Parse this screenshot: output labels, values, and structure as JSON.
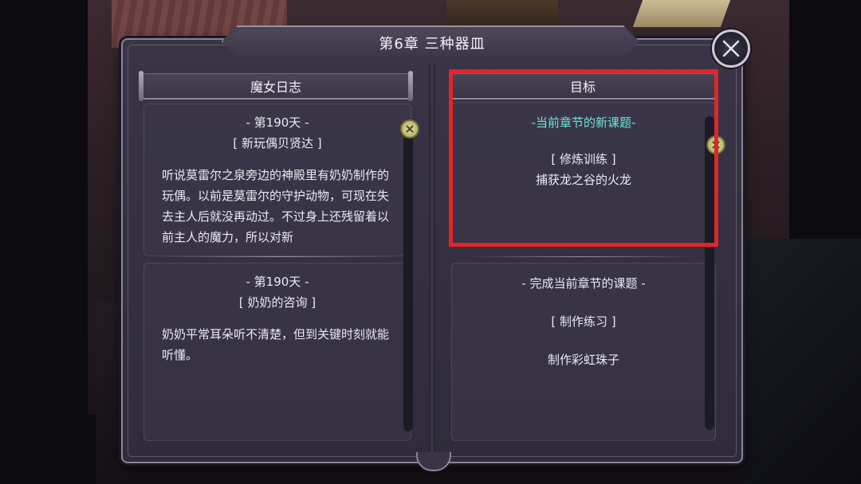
{
  "title": "第6章  三种器皿",
  "icons": {
    "close": "close-icon",
    "scroll_knob": "x-knob-icon"
  },
  "colors": {
    "accent": "#6fe6d8",
    "highlight": "#e0262b"
  },
  "left_page": {
    "header": "魔女日志",
    "entries": [
      {
        "day": "- 第190天 -",
        "title": "[ 新玩偶贝贤达 ]",
        "body": "听说莫雷尔之泉旁边的神殿里有奶奶制作的玩偶。以前是莫雷尔的守护动物，可现在失去主人后就没再动过。不过身上还残留着以前主人的魔力，所以对新"
      },
      {
        "day": "- 第190天 -",
        "title": "[ 奶奶的咨询 ]",
        "body": "奶奶平常耳朵听不清楚，但到关键时刻就能听懂。"
      }
    ]
  },
  "right_page": {
    "header": "目标",
    "objectives": [
      {
        "heading": "-当前章节的新课题-",
        "category": "[ 修炼训练 ]",
        "task": "捕获龙之谷的火龙"
      },
      {
        "heading": "- 完成当前章节的课题 -",
        "category": "[ 制作练习 ]",
        "task": "制作彩虹珠子"
      }
    ]
  }
}
